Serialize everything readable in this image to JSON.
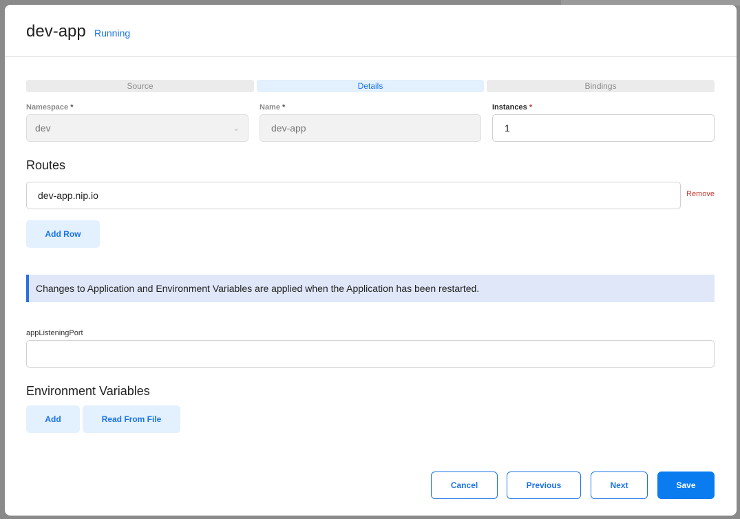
{
  "modal": {
    "title": "dev-app",
    "status": "Running",
    "status_color": "#1a73e8"
  },
  "steps": [
    {
      "label": "Source",
      "active": false
    },
    {
      "label": "Details",
      "active": true
    },
    {
      "label": "Bindings",
      "active": false
    }
  ],
  "fields": {
    "namespace": {
      "label": "Namespace",
      "required_mark": "*",
      "value": "dev",
      "icon": "chevron-down-icon"
    },
    "name": {
      "label": "Name",
      "required_mark": "*",
      "value": "dev-app"
    },
    "instances": {
      "label": "Instances",
      "required_mark": "*",
      "value": "1"
    }
  },
  "routes": {
    "title": "Routes",
    "rows": [
      {
        "value": "dev-app.nip.io",
        "remove_label": "Remove"
      }
    ],
    "add_row_label": "Add Row"
  },
  "banner": {
    "text": "Changes to Application and Environment Variables are applied when the Application has been restarted.",
    "accent_color": "#2d6ee0"
  },
  "app_listening_port": {
    "label": "appListeningPort",
    "value": ""
  },
  "env_vars": {
    "title": "Environment Variables",
    "add_label": "Add",
    "read_from_file_label": "Read From File"
  },
  "footer": {
    "cancel_label": "Cancel",
    "previous_label": "Previous",
    "next_label": "Next",
    "save_label": "Save",
    "primary_color": "#0a7cf0"
  }
}
